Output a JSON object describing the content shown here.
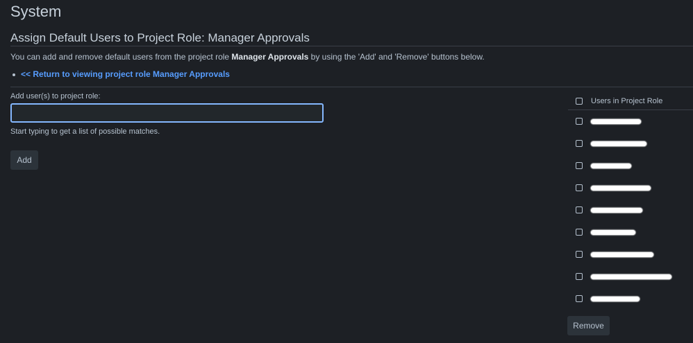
{
  "page_title": "System",
  "section_title": "Assign Default Users to Project Role: Manager Approvals",
  "description": {
    "before": "You can add and remove default users from the project role ",
    "role": "Manager Approvals",
    "after": " by using the 'Add' and 'Remove' buttons below."
  },
  "return_link": "<< Return to viewing project role Manager Approvals",
  "add_users": {
    "label": "Add user(s) to project role:",
    "value": "",
    "help": "Start typing to get a list of possible matches.",
    "button": "Add"
  },
  "role_users": {
    "header": "Users in Project Role",
    "users": [
      {
        "name": "",
        "redacted": true,
        "checked": false
      },
      {
        "name": "",
        "redacted": true,
        "checked": false
      },
      {
        "name": "",
        "redacted": true,
        "checked": false
      },
      {
        "name": "",
        "redacted": true,
        "checked": false
      },
      {
        "name": "",
        "redacted": true,
        "checked": false
      },
      {
        "name": "",
        "redacted": true,
        "checked": false
      },
      {
        "name": "",
        "redacted": true,
        "checked": false
      },
      {
        "name": "",
        "redacted": true,
        "checked": false
      },
      {
        "name": "",
        "redacted": true,
        "checked": false
      }
    ],
    "remove_button": "Remove"
  },
  "colors": {
    "background": "#1d2025",
    "link": "#579dff",
    "input_focus": "#85b8ff",
    "button_bg": "#2c333a"
  }
}
